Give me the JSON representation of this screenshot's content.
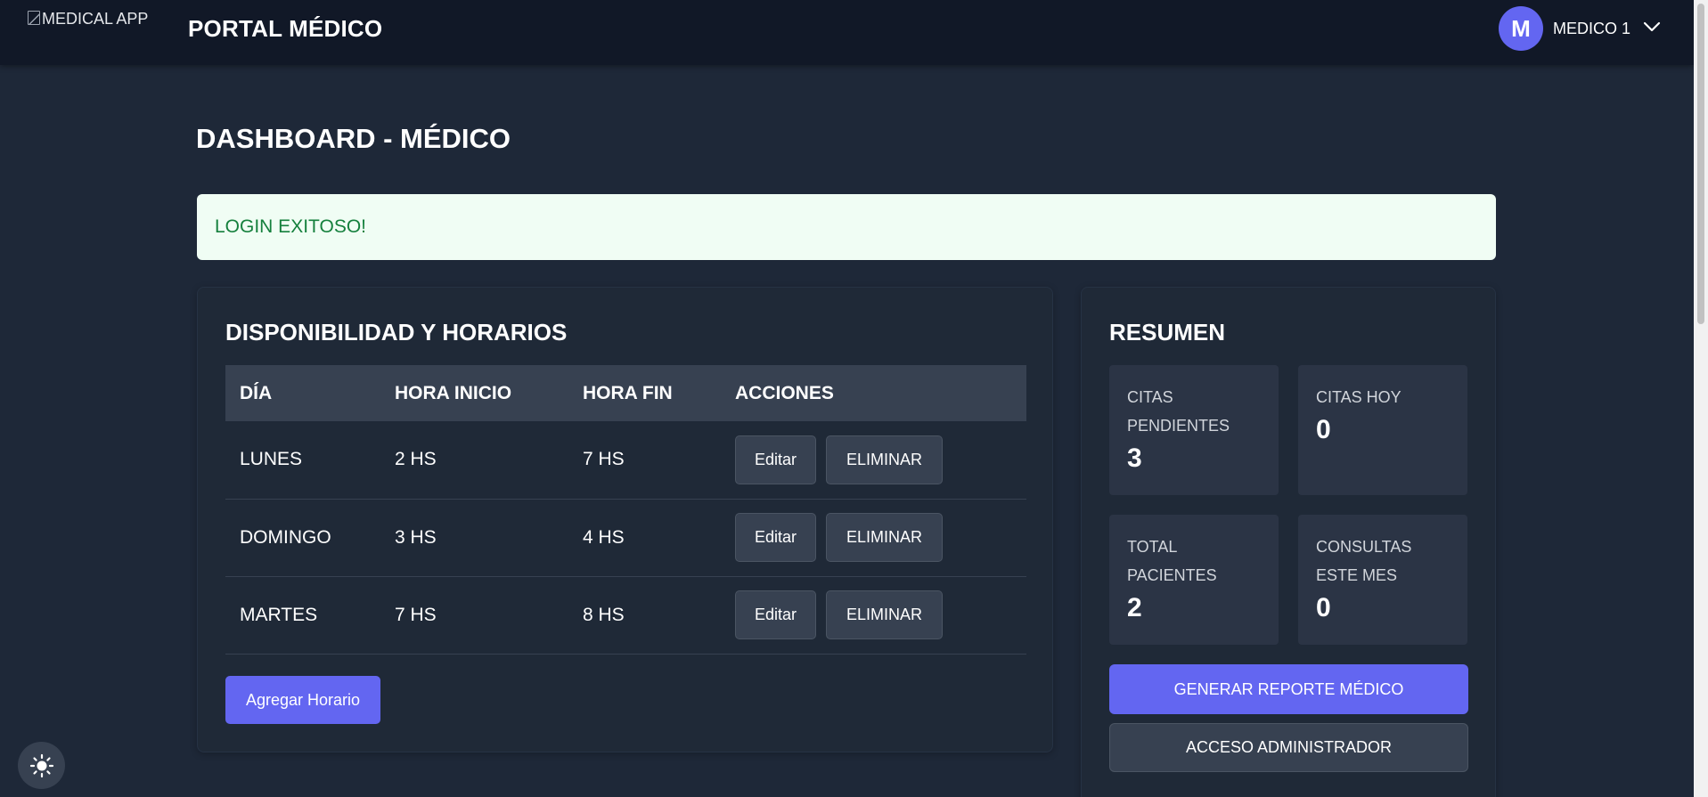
{
  "header": {
    "logo_alt": "MEDICAL APP",
    "brand": "PORTAL MÉDICO",
    "avatar_initial": "M",
    "user_name": "MEDICO 1"
  },
  "page": {
    "title": "DASHBOARD - MÉDICO"
  },
  "alert": {
    "message": "LOGIN EXITOSO!"
  },
  "schedule": {
    "title": "DISPONIBILIDAD Y HORARIOS",
    "columns": [
      "DÍA",
      "HORA INICIO",
      "HORA FIN",
      "ACCIONES"
    ],
    "rows": [
      {
        "day": "LUNES",
        "start": "2 HS",
        "end": "7 HS"
      },
      {
        "day": "DOMINGO",
        "start": "3 HS",
        "end": "4 HS"
      },
      {
        "day": "MARTES",
        "start": "7 HS",
        "end": "8 HS"
      }
    ],
    "edit_label": "Editar",
    "delete_label": "ELIMINAR",
    "add_label": "Agregar Horario"
  },
  "summary": {
    "title": "RESUMEN",
    "stats": [
      {
        "label": "CITAS PENDIENTES",
        "value": "3"
      },
      {
        "label": "CITAS HOY",
        "value": "0"
      },
      {
        "label": "TOTAL PACIENTES",
        "value": "2"
      },
      {
        "label": "CONSULTAS ESTE MES",
        "value": "0"
      }
    ],
    "report_label": "GENERAR REPORTE MÉDICO",
    "admin_label": "ACCESO ADMINISTRADOR"
  },
  "colors": {
    "background": "#1e2838",
    "topbar": "#111827",
    "accent": "#6366f1",
    "success_bg": "#f0fdf4",
    "success_text": "#15803d"
  },
  "icons": {
    "chevron": "chevron-down-icon",
    "theme": "sun-icon"
  }
}
